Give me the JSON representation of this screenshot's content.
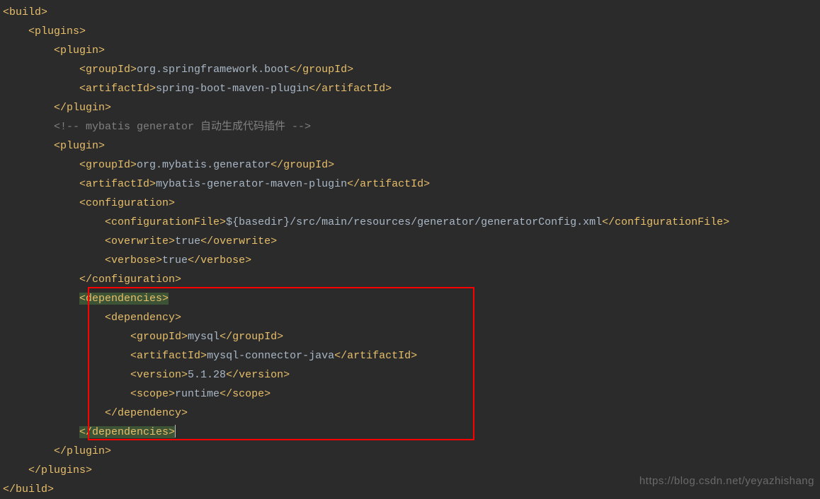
{
  "lines": {
    "l1_open": "<build>",
    "l2_open": "<plugins>",
    "l3_open": "<plugin>",
    "l4_a": "<groupId>",
    "l4_t": "org.springframework.boot",
    "l4_b": "</groupId>",
    "l5_a": "<artifactId>",
    "l5_t": "spring-boot-maven-plugin",
    "l5_b": "</artifactId>",
    "l6_close": "</plugin>",
    "l7_comment": "<!-- mybatis generator 自动生成代码插件 -->",
    "l8_open": "<plugin>",
    "l9_a": "<groupId>",
    "l9_t": "org.mybatis.generator",
    "l9_b": "</groupId>",
    "l10_a": "<artifactId>",
    "l10_t": "mybatis-generator-maven-plugin",
    "l10_b": "</artifactId>",
    "l11_open": "<configuration>",
    "l12_a": "<configurationFile>",
    "l12_t": "${basedir}/src/main/resources/generator/generatorConfig.xml",
    "l12_b": "</configurationFile>",
    "l13_a": "<overwrite>",
    "l13_t": "true",
    "l13_b": "</overwrite>",
    "l14_a": "<verbose>",
    "l14_t": "true",
    "l14_b": "</verbose>",
    "l15_close": "</configuration>",
    "l16_open": "<dependencies>",
    "l17_open": "<dependency>",
    "l18_a": "<groupId>",
    "l18_t": "mysql",
    "l18_b": "</groupId>",
    "l19_a": "<artifactId>",
    "l19_t": "mysql-connector-java",
    "l19_b": "</artifactId>",
    "l20_a": "<version>",
    "l20_t": "5.1.28",
    "l20_b": "</version>",
    "l21_a": "<scope>",
    "l21_t": "runtime",
    "l21_b": "</scope>",
    "l22_close": "</dependency>",
    "l23_close": "</dependencies>",
    "l24_close": "</plugin>",
    "l25_close": "</plugins>",
    "l26_close": "</build>"
  },
  "indent": {
    "i0": "",
    "i1": "    ",
    "i2": "        ",
    "i3": "            ",
    "i4": "                ",
    "i5": "                    "
  },
  "watermark": "https://blog.csdn.net/yeyazhishang"
}
